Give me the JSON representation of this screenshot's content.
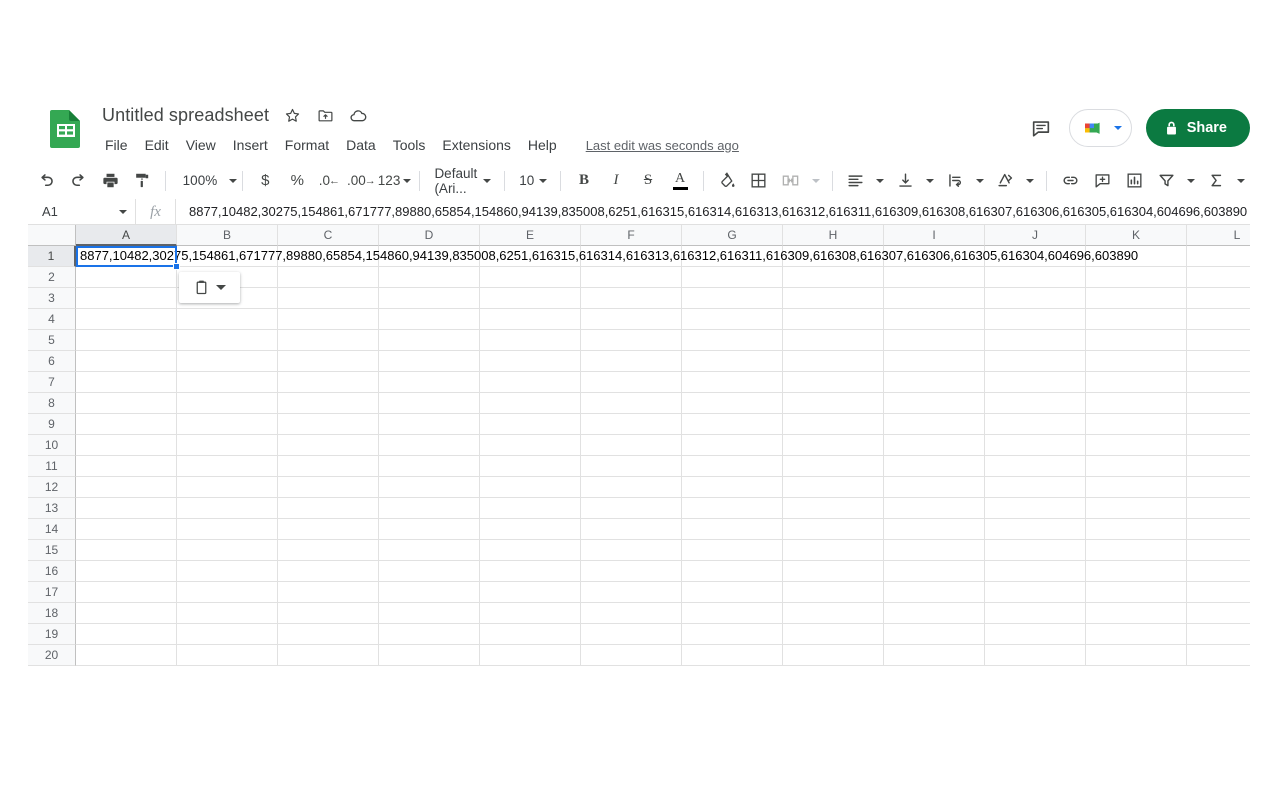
{
  "header": {
    "doc_title": "Untitled spreadsheet",
    "doc_icon": "sheets-logo-icon",
    "star_icon": "star-icon",
    "move_icon": "move-to-folder-icon",
    "cloud_icon": "cloud-saved-icon",
    "menus": [
      "File",
      "Edit",
      "View",
      "Insert",
      "Format",
      "Data",
      "Tools",
      "Extensions",
      "Help"
    ],
    "last_edit": "Last edit was seconds ago",
    "comment_icon": "comment-history-icon",
    "meet_icon": "google-meet-icon",
    "share_label": "Share",
    "share_lock_icon": "lock-icon",
    "share_color": "#0b7a41"
  },
  "toolbar": {
    "undo": "undo-icon",
    "redo": "redo-icon",
    "print": "print-icon",
    "paint": "paint-format-icon",
    "zoom_value": "100%",
    "currency": "$",
    "percent": "%",
    "decrease_decimal": ".0",
    "increase_decimal": ".00",
    "more_formats": "123",
    "font_value": "Default (Ari...",
    "font_size_value": "10",
    "bold": "B",
    "italic": "I",
    "strikethrough": "S",
    "text_color": "A",
    "text_color_swatch": "#000000",
    "fill_color": "fill-color-icon",
    "borders": "borders-icon",
    "merge_cells": "merge-cells-icon",
    "horizontal_align": "horizontal-align-icon",
    "vertical_align": "vertical-align-icon",
    "text_wrap": "text-wrap-icon",
    "text_rotation": "text-rotation-icon",
    "insert_link": "link-icon",
    "insert_comment": "insert-comment-icon",
    "insert_chart": "insert-chart-icon",
    "create_filter": "filter-icon",
    "functions": "sigma-functions-icon"
  },
  "formula_bar": {
    "name_box": "A1",
    "fx_label": "fx",
    "value": "8877,10482,30275,154861,671777,89880,65854,154860,94139,835008,6251,616315,616314,616313,616312,616311,616309,616308,616307,616306,616305,616304,604696,603890"
  },
  "grid": {
    "columns": [
      "A",
      "B",
      "C",
      "D",
      "E",
      "F",
      "G",
      "H",
      "I",
      "J",
      "K",
      "L"
    ],
    "rows": [
      1,
      2,
      3,
      4,
      5,
      6,
      7,
      8,
      9,
      10,
      11,
      12,
      13,
      14,
      15,
      16,
      17,
      18,
      19,
      20
    ],
    "selected_cell": "A1",
    "selected_column": "A",
    "selected_row": 1,
    "a1_value": "8877,10482,30275,154861,671777,89880,65854,154860,94139,835008,6251,616315,616314,616313,616312,616311,616309,616308,616307,616306,616305,616304,604696,603890",
    "selection_color": "#1a73e8"
  },
  "paste_popup": {
    "clipboard_icon": "clipboard-icon",
    "dropdown_icon": "chevron-down-icon"
  }
}
